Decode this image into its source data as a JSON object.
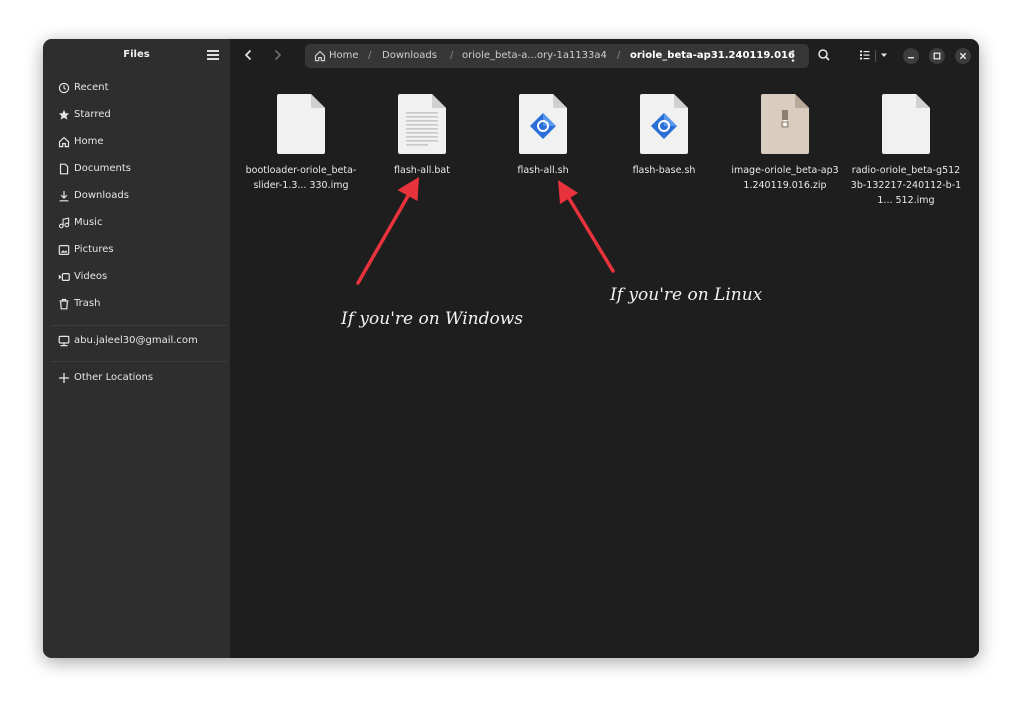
{
  "window": {
    "title": "Files"
  },
  "sidebar": {
    "items": [
      {
        "label": "Recent",
        "icon": "clock-icon"
      },
      {
        "label": "Starred",
        "icon": "star-icon"
      },
      {
        "label": "Home",
        "icon": "home-icon"
      },
      {
        "label": "Documents",
        "icon": "document-icon"
      },
      {
        "label": "Downloads",
        "icon": "download-icon"
      },
      {
        "label": "Music",
        "icon": "music-icon"
      },
      {
        "label": "Pictures",
        "icon": "picture-icon"
      },
      {
        "label": "Videos",
        "icon": "video-icon"
      },
      {
        "label": "Trash",
        "icon": "trash-icon"
      }
    ],
    "account": {
      "label": "abu.jaleel30@gmail.com",
      "icon": "network-drive-icon"
    },
    "other": {
      "label": "Other Locations",
      "icon": "plus-icon"
    }
  },
  "path": {
    "crumbs": [
      "Home",
      "Downloads",
      "oriole_beta-a...ory-1a1133a4",
      "oriole_beta-ap31.240119.016"
    ],
    "separator": "/"
  },
  "files": [
    {
      "name": "bootloader-oriole_beta-slider-1.3... 330.img",
      "type": "blank"
    },
    {
      "name": "flash-all.bat",
      "type": "text"
    },
    {
      "name": "flash-all.sh",
      "type": "script"
    },
    {
      "name": "flash-base.sh",
      "type": "script"
    },
    {
      "name": "image-oriole_beta-ap31.240119.016.zip",
      "type": "zip"
    },
    {
      "name": "radio-oriole_beta-g5123b-132217-240112-b-11... 512.img",
      "type": "blank"
    }
  ],
  "annotations": {
    "windows": "If you're on Windows",
    "linux": "If you're on Linux"
  },
  "colors": {
    "accent": "#e8323c",
    "sidebar": "#2e2e2e",
    "content": "#1e1e1e",
    "script_blue": "#2a6fd8"
  }
}
